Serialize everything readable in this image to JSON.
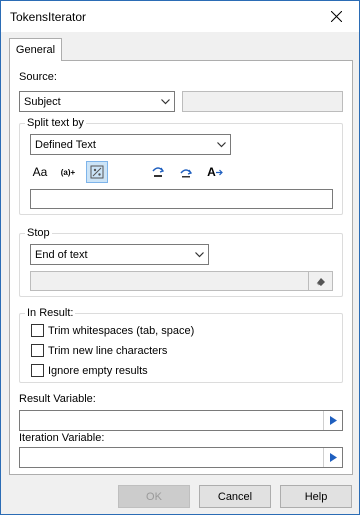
{
  "window": {
    "title": "TokensIterator"
  },
  "tabs": [
    {
      "label": "General"
    }
  ],
  "source": {
    "label": "Source:",
    "selected": "Subject",
    "text_value": ""
  },
  "split": {
    "legend": "Split text by",
    "selected": "Defined Text",
    "tools": [
      {
        "icon": "match-case-icon",
        "text": "Aa"
      },
      {
        "icon": "whole-word-icon",
        "text": "(a)+"
      },
      {
        "icon": "regex-icon",
        "text": ""
      },
      {
        "icon": "step-over-icon",
        "text": ""
      },
      {
        "icon": "skip-icon",
        "text": ""
      },
      {
        "icon": "replace-text-icon",
        "text": "A"
      }
    ],
    "value": ""
  },
  "stop": {
    "legend": "Stop",
    "selected": "End of text",
    "value": ""
  },
  "in_result": {
    "legend": "In Result:",
    "options": [
      {
        "label": "Trim whitespaces (tab, space)",
        "checked": false
      },
      {
        "label": "Trim new line characters",
        "checked": false
      },
      {
        "label": "Ignore empty results",
        "checked": false
      }
    ]
  },
  "result_variable": {
    "label": "Result Variable:",
    "value": ""
  },
  "iteration_variable": {
    "label": "Iteration Variable:",
    "value": ""
  },
  "buttons": {
    "ok": "OK",
    "cancel": "Cancel",
    "help": "Help"
  },
  "colors": {
    "title_bg": "#ffffff",
    "window_border": "#2b6cb5",
    "browse_arrow": "#1f5fbf",
    "active_tool": "#cce4f7"
  }
}
